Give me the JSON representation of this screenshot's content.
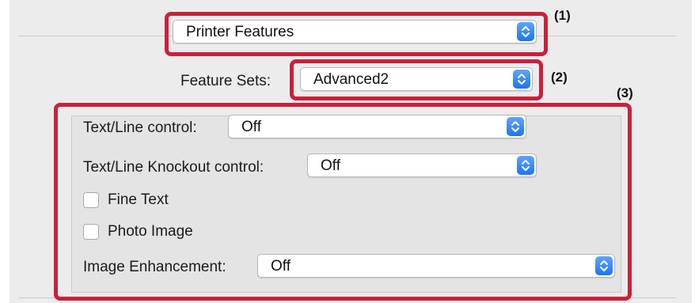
{
  "menu_selector": {
    "value": "Printer Features"
  },
  "feature_sets": {
    "label": "Feature Sets:",
    "value": "Advanced2"
  },
  "settings": {
    "text_line_control": {
      "label": "Text/Line control:",
      "value": "Off"
    },
    "text_line_knockout": {
      "label": "Text/Line Knockout control:",
      "value": "Off"
    },
    "fine_text": {
      "label": "Fine Text",
      "checked": false
    },
    "photo_image": {
      "label": "Photo Image",
      "checked": false
    },
    "image_enhancement": {
      "label": "Image Enhancement:",
      "value": "Off"
    }
  },
  "callouts": {
    "c1": "(1)",
    "c2": "(2)",
    "c3": "(3)"
  },
  "colors": {
    "highlight": "#cc1f3a",
    "stepper": "#1f74f0",
    "panel": "#ececec"
  },
  "icons": {
    "stepper": "up-down-chevron-icon"
  }
}
